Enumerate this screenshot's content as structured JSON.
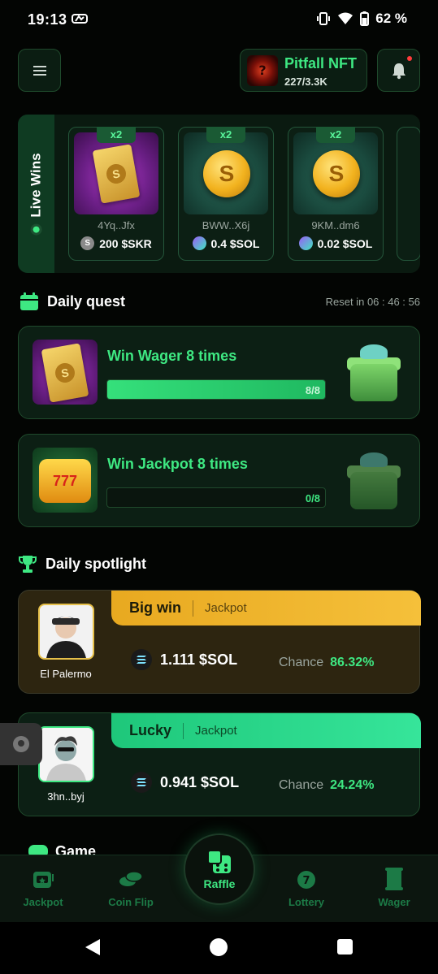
{
  "status": {
    "time": "19:13",
    "battery": "62 %"
  },
  "header": {
    "nft_title": "Pitfall NFT",
    "nft_count": "227/3.3K"
  },
  "live_wins": {
    "label": "Live Wins",
    "cards": [
      {
        "multiplier": "x2",
        "user": "4Yq..Jfx",
        "amount": "200 $SKR",
        "item": "card-pack"
      },
      {
        "multiplier": "x2",
        "user": "BWW..X6j",
        "amount": "0.4 $SOL",
        "item": "gold-coin"
      },
      {
        "multiplier": "x2",
        "user": "9KM..dm6",
        "amount": "0.02 $SOL",
        "item": "gold-coin"
      }
    ]
  },
  "daily_quest": {
    "title": "Daily quest",
    "reset": "Reset in 06 : 46 : 56",
    "quests": [
      {
        "title": "Win Wager 8 times",
        "progress": "8/8",
        "fraction": 1.0
      },
      {
        "title": "Win Jackpot 8 times",
        "progress": "0/8",
        "fraction": 0.0
      }
    ]
  },
  "spotlight": {
    "title": "Daily spotlight",
    "entries": [
      {
        "kind": "Big win",
        "game": "Jackpot",
        "user": "El Palermo",
        "amount": "1.111 $SOL",
        "chance_label": "Chance",
        "chance": "86.32%"
      },
      {
        "kind": "Lucky",
        "game": "Jackpot",
        "user": "3hn..byj",
        "amount": "0.941 $SOL",
        "chance_label": "Chance",
        "chance": "24.24%"
      }
    ]
  },
  "game_section": {
    "title": "Game"
  },
  "nav": {
    "jackpot": "Jackpot",
    "coin_flip": "Coin Flip",
    "raffle": "Raffle",
    "lottery": "Lottery",
    "wager": "Wager"
  },
  "colors": {
    "accent": "#3ee882",
    "gold": "#f2b21e",
    "background": "#030503"
  }
}
